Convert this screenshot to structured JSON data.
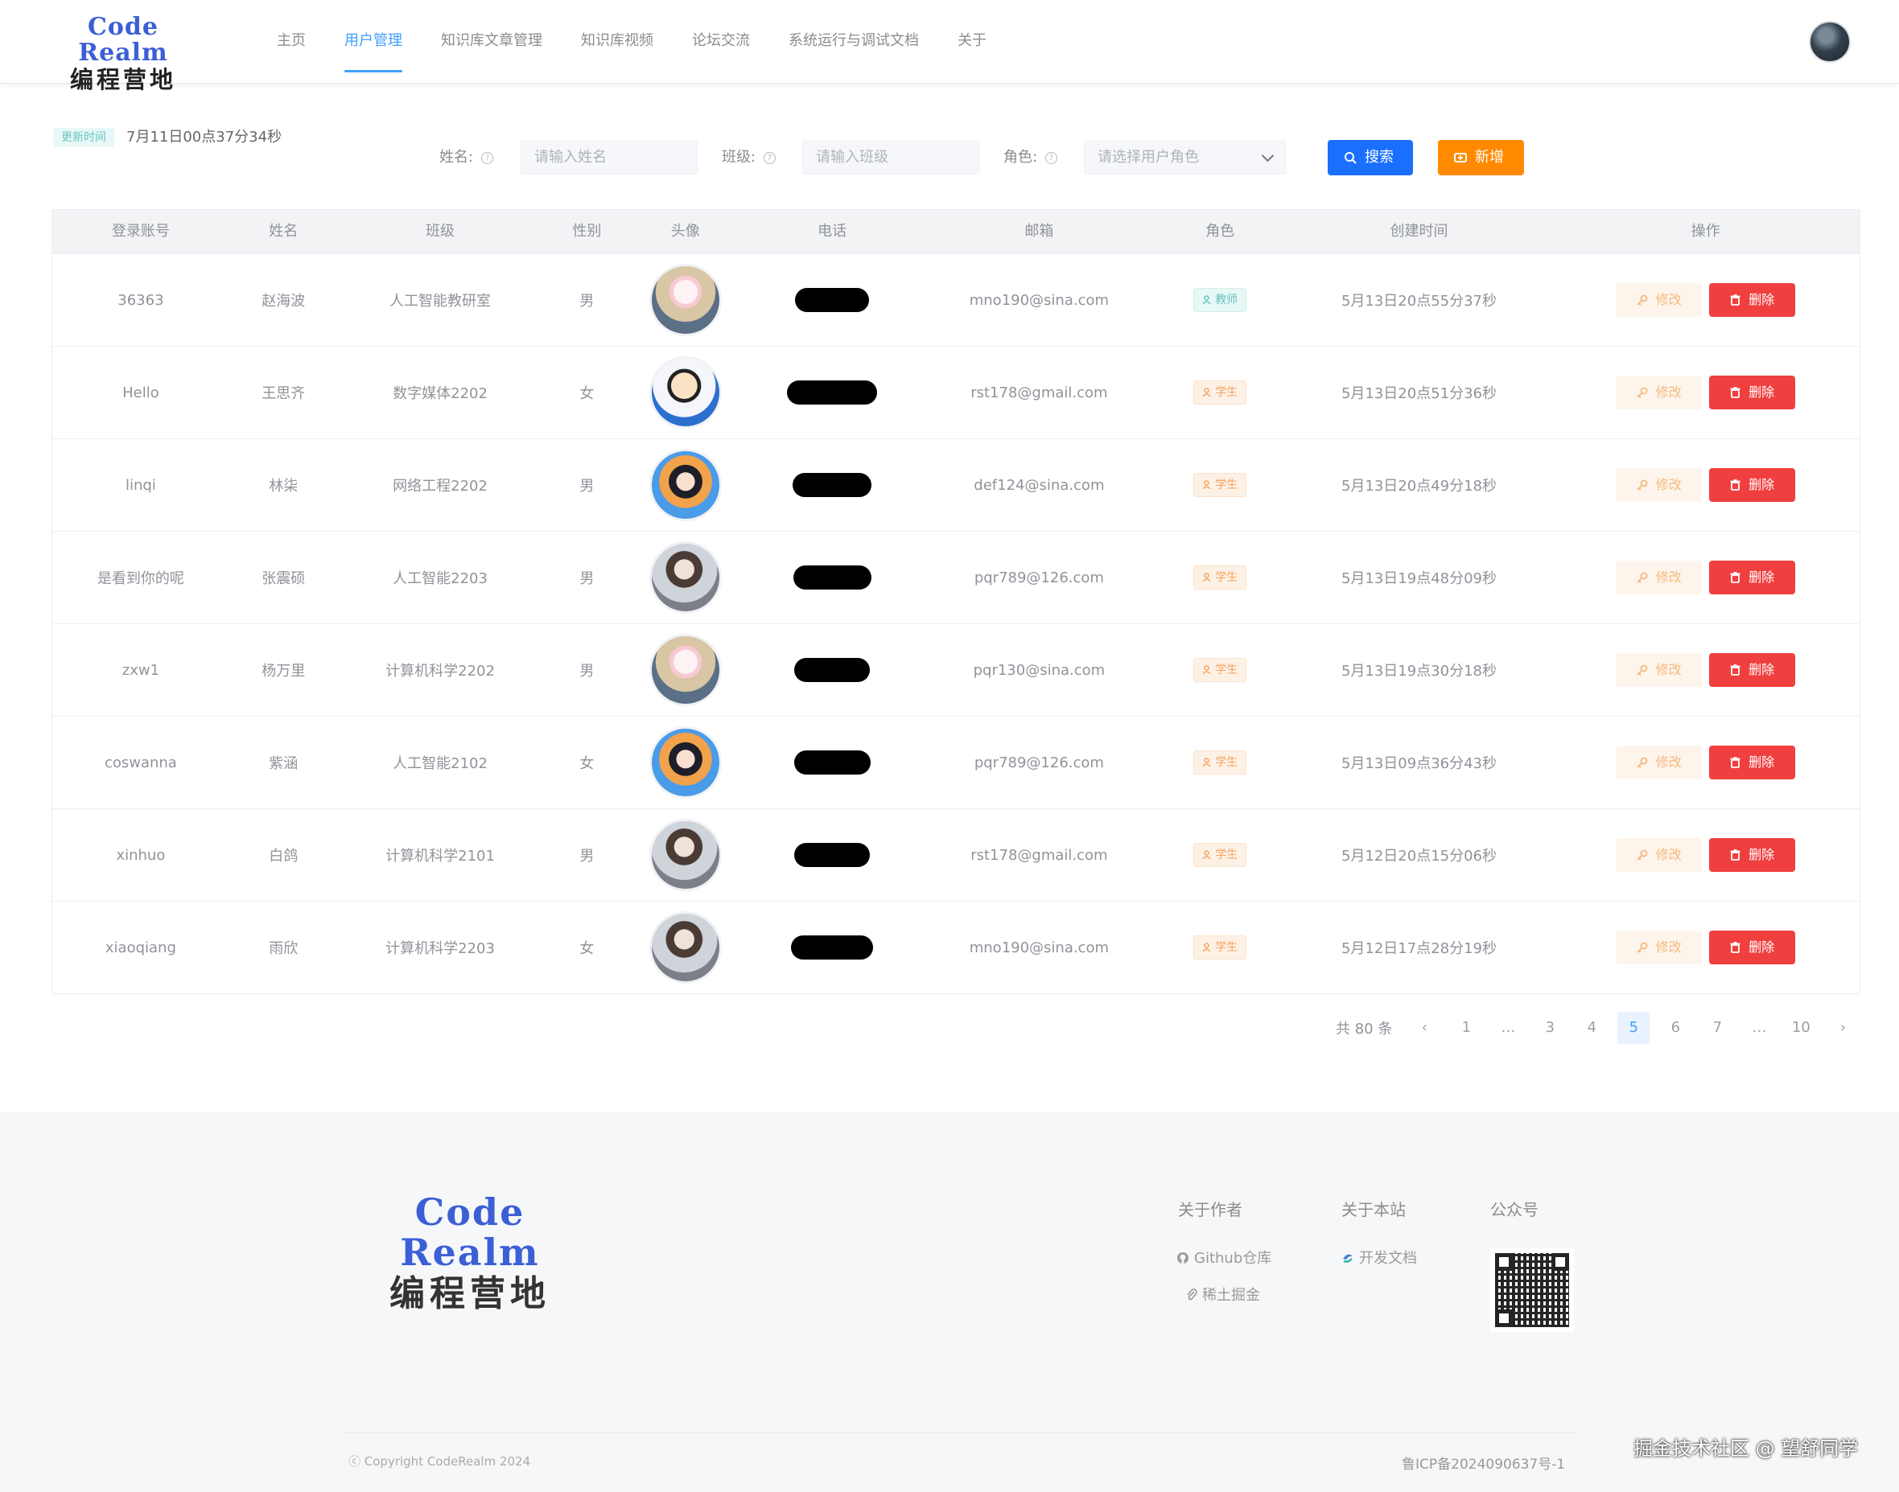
{
  "brand": {
    "logo_en": "Code Realm",
    "logo_cn": "编程营地"
  },
  "nav": {
    "items": [
      {
        "label": "主页"
      },
      {
        "label": "用户管理",
        "active": true
      },
      {
        "label": "知识库文章管理"
      },
      {
        "label": "知识库视频"
      },
      {
        "label": "论坛交流"
      },
      {
        "label": "系统运行与调试文档"
      },
      {
        "label": "关于"
      }
    ]
  },
  "status": {
    "badge": "更新时间",
    "update_time": "7月11日00点37分34秒"
  },
  "search": {
    "name_label": "姓名:",
    "name_placeholder": "请输入姓名",
    "class_label": "班级:",
    "class_placeholder": "请输入班级",
    "role_label": "角色:",
    "role_placeholder": "请选择用户角色",
    "search_button": "搜索",
    "add_button": "新增"
  },
  "table": {
    "columns": [
      "登录账号",
      "姓名",
      "班级",
      "性别",
      "头像",
      "电话",
      "邮箱",
      "角色",
      "创建时间",
      "操作"
    ],
    "edit_label": "修改",
    "delete_label": "删除",
    "rows": [
      {
        "account": "36363",
        "name": "赵海波",
        "class": "人工智能教研室",
        "gender": "男",
        "avatar": "rabbit",
        "email": "mno190@sina.com",
        "role": "教师",
        "role_type": "teacher",
        "created": "5月13日20点55分37秒"
      },
      {
        "account": "Hello",
        "name": "王思齐",
        "class": "数字媒体2202",
        "gender": "女",
        "avatar": "shin",
        "email": "rst178@gmail.com",
        "role": "学生",
        "role_type": "student",
        "created": "5月13日20点51分36秒"
      },
      {
        "account": "linqi",
        "name": "林柒",
        "class": "网络工程2202",
        "gender": "男",
        "avatar": "girl",
        "email": "def124@sina.com",
        "role": "学生",
        "role_type": "student",
        "created": "5月13日20点49分18秒"
      },
      {
        "account": "是看到你的呢",
        "name": "张震硕",
        "class": "人工智能2203",
        "gender": "男",
        "avatar": "boy",
        "email": "pqr789@126.com",
        "role": "学生",
        "role_type": "student",
        "created": "5月13日19点48分09秒"
      },
      {
        "account": "zxw1",
        "name": "杨万里",
        "class": "计算机科学2202",
        "gender": "男",
        "avatar": "rabbit",
        "email": "pqr130@sina.com",
        "role": "学生",
        "role_type": "student",
        "created": "5月13日19点30分18秒"
      },
      {
        "account": "coswanna",
        "name": "紫涵",
        "class": "人工智能2102",
        "gender": "女",
        "avatar": "girl",
        "email": "pqr789@126.com",
        "role": "学生",
        "role_type": "student",
        "created": "5月13日09点36分43秒"
      },
      {
        "account": "xinhuo",
        "name": "白鸽",
        "class": "计算机科学2101",
        "gender": "男",
        "avatar": "boy",
        "email": "rst178@gmail.com",
        "role": "学生",
        "role_type": "student",
        "created": "5月12日20点15分06秒"
      },
      {
        "account": "xiaoqiang",
        "name": "雨欣",
        "class": "计算机科学2203",
        "gender": "女",
        "avatar": "boy",
        "email": "mno190@sina.com",
        "role": "学生",
        "role_type": "student",
        "created": "5月12日17点28分19秒"
      }
    ]
  },
  "pagination": {
    "total": "共 80 条",
    "pages": [
      "1",
      "…",
      "3",
      "4",
      "5",
      "6",
      "7",
      "…",
      "10"
    ],
    "current": "5"
  },
  "footer": {
    "col_author": "关于作者",
    "col_site": "关于本站",
    "col_wechat": "公众号",
    "link_github": "Github仓库",
    "link_juejin": "稀土掘金",
    "link_docs": "开发文档",
    "copyright": "ⓒ Copyright CodeRealm 2024",
    "icp": "鲁ICP备2024090637号-1"
  },
  "watermark": "掘金技术社区 @ 望舒同学",
  "colors": {
    "primary": "#1a6fff",
    "accent": "#ff8a00",
    "danger": "#f03f3f",
    "nav_active": "#409eff"
  }
}
